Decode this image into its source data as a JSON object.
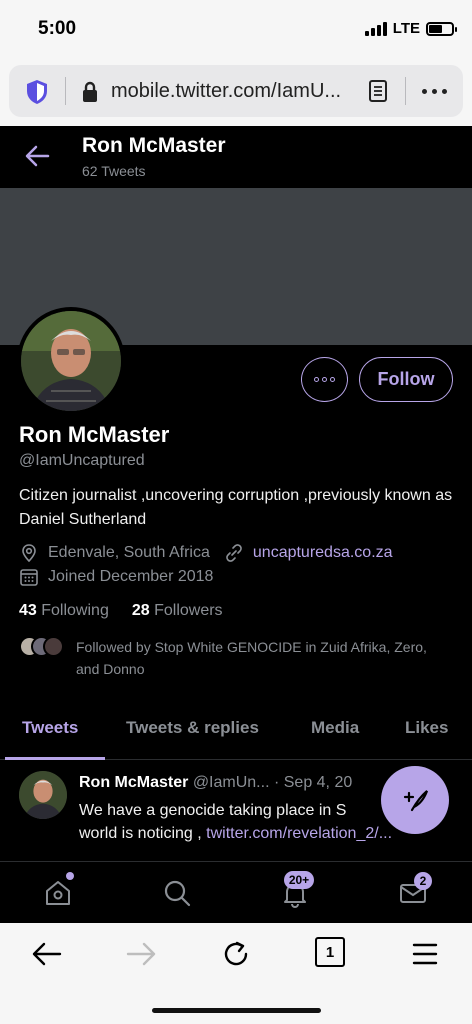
{
  "status_bar": {
    "time": "5:00",
    "network": "LTE"
  },
  "browser": {
    "url": "mobile.twitter.com/IamU..."
  },
  "header": {
    "name": "Ron McMaster",
    "tweet_count": "62 Tweets"
  },
  "profile": {
    "follow_label": "Follow",
    "name": "Ron McMaster",
    "handle": "@IamUncaptured",
    "bio": "Citizen journalist ,uncovering corruption ,previously known as Daniel Sutherland",
    "location": "Edenvale, South Africa",
    "website": "uncapturedsa.co.za",
    "joined": "Joined December 2018",
    "following_count": "43",
    "following_label": "Following",
    "followers_count": "28",
    "followers_label": "Followers",
    "followed_by": "Followed by Stop White GENOCIDE in Zuid Afrika, Zero, and Donno"
  },
  "tabs": [
    {
      "label": "Tweets",
      "active": true
    },
    {
      "label": "Tweets & replies",
      "active": false
    },
    {
      "label": "Media",
      "active": false
    },
    {
      "label": "Likes",
      "active": false
    }
  ],
  "tweet": {
    "name": "Ron McMaster",
    "handle": "@IamUn...",
    "date": "· Sep 4, 20",
    "text": "We have a genocide taking place in S",
    "text2": "world is noticing , ",
    "link": "twitter.com/revelation_2/..."
  },
  "bottom_nav": {
    "notifications_badge": "20+",
    "messages_badge": "2"
  },
  "safari": {
    "tab_count": "1"
  },
  "colors": {
    "accent": "#b7a5e8",
    "background": "#000000",
    "muted": "#8b8f95",
    "banner": "#3e4246"
  }
}
